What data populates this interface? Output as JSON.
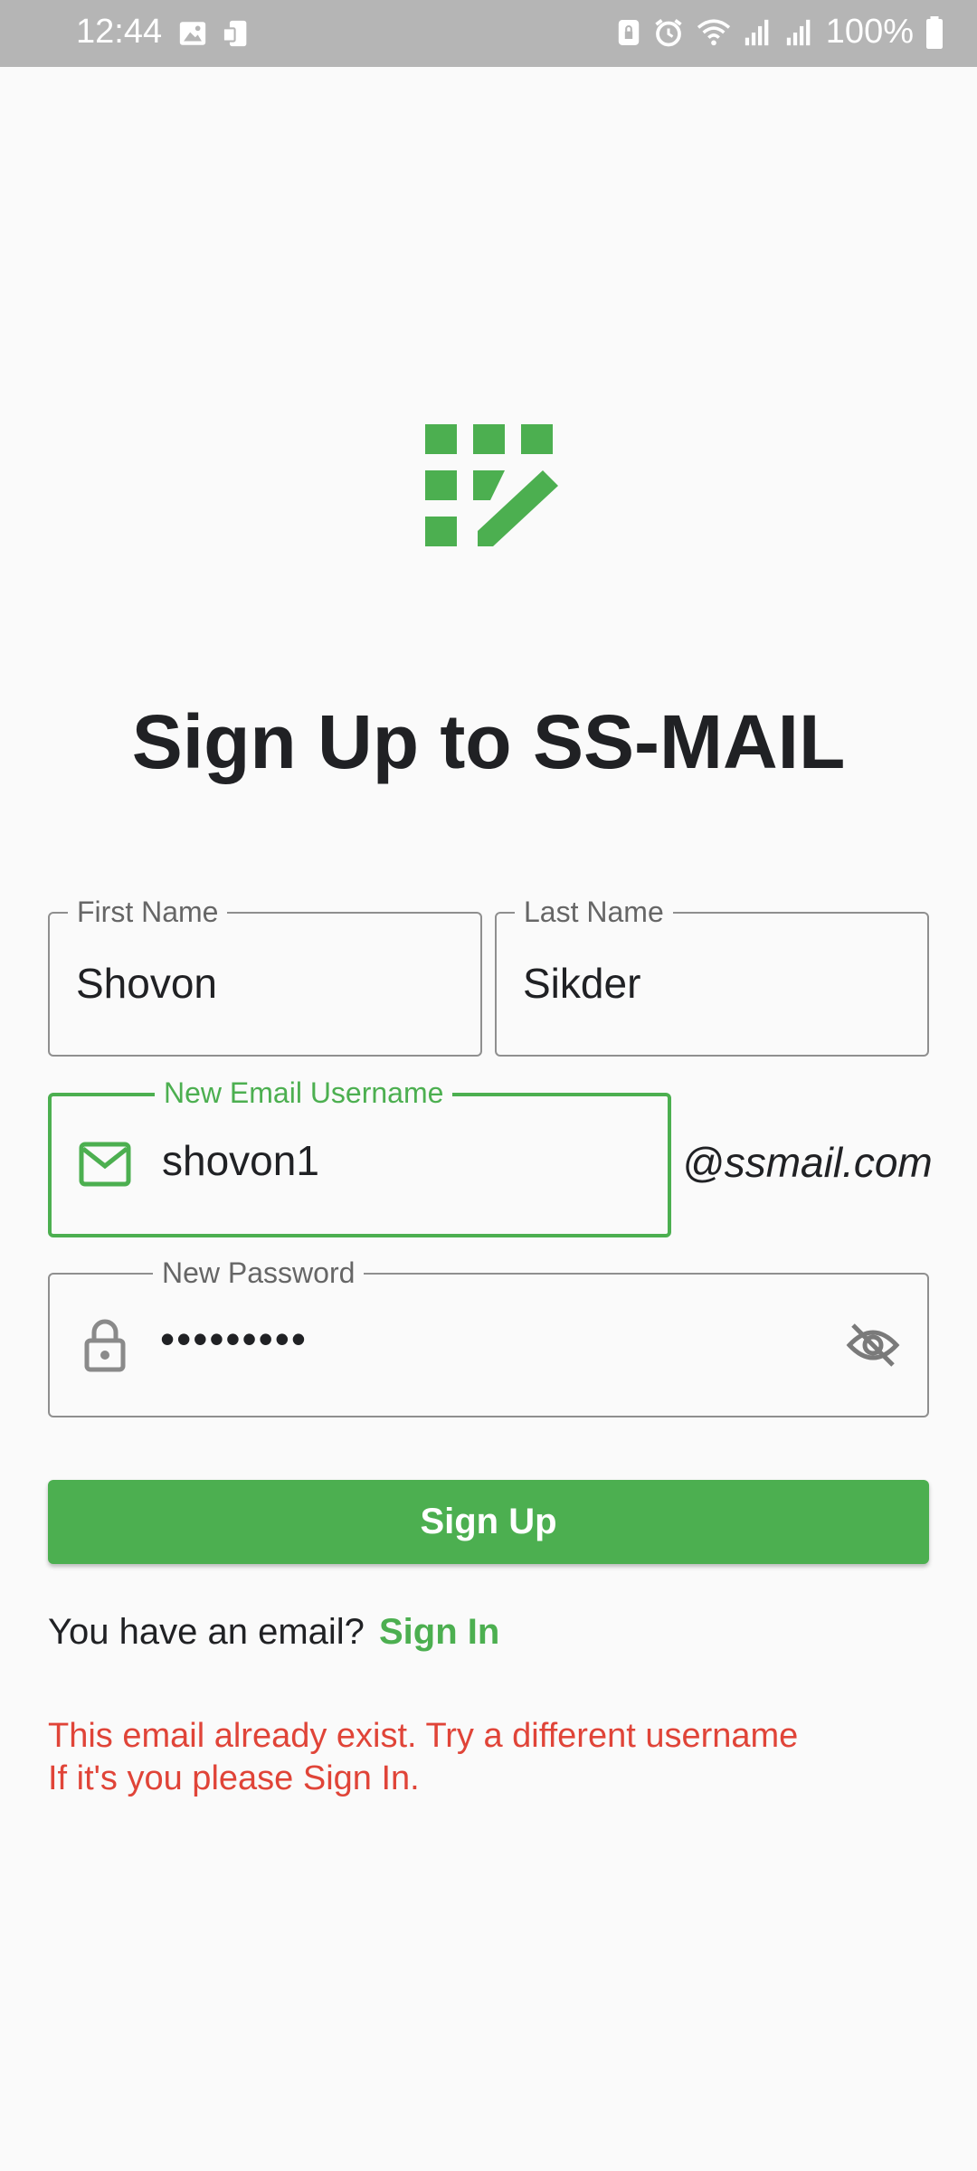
{
  "status_bar": {
    "time": "12:44",
    "battery": "100%"
  },
  "page": {
    "title": "Sign Up to SS-MAIL",
    "brand_color": "#4caf50",
    "error_color": "#e04438"
  },
  "form": {
    "first_name": {
      "label": "First Name",
      "value": "Shovon"
    },
    "last_name": {
      "label": "Last Name",
      "value": "Sikder"
    },
    "email": {
      "label": "New Email Username",
      "value": "shovon1",
      "suffix": "@ssmail.com",
      "icon": "mail-icon"
    },
    "password": {
      "label": "New Password",
      "value": "•••••••••",
      "icon": "lock-icon",
      "toggle_icon": "eye-off-icon"
    },
    "submit_label": "Sign Up"
  },
  "footer": {
    "prompt": "You have an email?",
    "link_label": "Sign In"
  },
  "error": {
    "line1": "This email already exist. Try a different username",
    "line2": "If it's you please Sign In."
  }
}
